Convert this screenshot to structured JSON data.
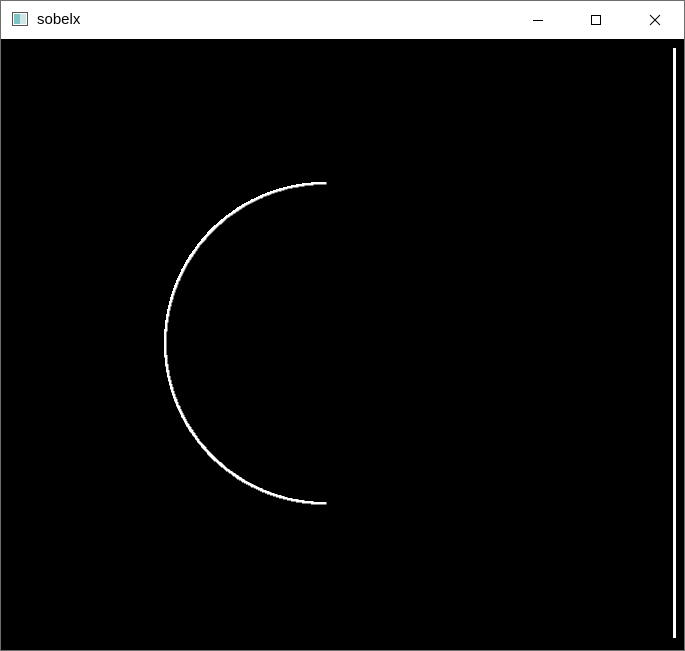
{
  "window": {
    "title": "sobelx",
    "icon": "app-window-icon",
    "controls": [
      {
        "name": "minimize-button",
        "icon": "minimize-icon"
      },
      {
        "name": "maximize-button",
        "icon": "maximize-icon"
      },
      {
        "name": "close-button",
        "icon": "close-icon"
      }
    ]
  },
  "image": {
    "background_color": "#000000",
    "edge_color": "#ffffff",
    "icon_colors": {
      "frame": "#555555",
      "pane": "#7fc3c4"
    }
  }
}
